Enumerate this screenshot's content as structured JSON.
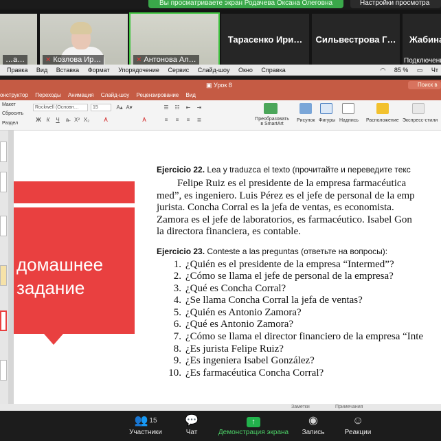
{
  "zoom": {
    "share_banner": "Вы просматриваете экран Родачева Оксана Олеговна",
    "view_options": "Настройки просмотра",
    "participants": [
      {
        "name": "",
        "label": "…а…"
      },
      {
        "name": "Козлова Ир…",
        "muted": true
      },
      {
        "name": "Антонова Ал…",
        "muted": true
      },
      {
        "name": "Тарасенко Ири…"
      },
      {
        "name": "Сильвестрова Г…"
      },
      {
        "name": "Жабина",
        "sub": "Подключение"
      }
    ],
    "toolbar": {
      "participants_label": "Участники",
      "participants_count": "15",
      "chat_label": "Чат",
      "share_label": "Демонстрация экрана",
      "record_label": "Запись",
      "reactions_label": "Реакции"
    }
  },
  "menubar": {
    "items": [
      "Правка",
      "Вид",
      "Вставка",
      "Формат",
      "Упорядочение",
      "Сервис",
      "Слайд-шоу",
      "Окно",
      "Справка"
    ],
    "battery": "85 %",
    "day": "Чт"
  },
  "powerpoint": {
    "doc_title": "Урок 8",
    "search_placeholder": "Поиск в",
    "tabs": [
      "онструктор",
      "Переходы",
      "Анимация",
      "Слайд-шоу",
      "Рецензирование",
      "Вид"
    ],
    "ribbon": {
      "layout": "Макет",
      "reset": "Сбросить",
      "section": "Раздел",
      "font": "Rockwell (Основн…",
      "size": "15",
      "smartart": "Преобразовать в SmartArt",
      "picture": "Рисунок",
      "shapes": "Фигуры",
      "textbox": "Надпись",
      "arrange": "Расположение",
      "quickstyles": "Экспресс-стили"
    },
    "status": {
      "notes": "Заметки",
      "comments": "Примечания"
    }
  },
  "slide": {
    "title_line1": "домашнее",
    "title_line2": "задание",
    "ex22_head_bold": "Ejercicio 22.",
    "ex22_head": "Lea y traduzca el texto (прочитайте и переведите текс",
    "ex22_lines": [
      "Felipe Ruiz es el presidente de la empresa farmacéutica",
      "med”, es ingeniero. Luis Pérez es el jefe de personal de la emp",
      "jurista. Concha Corral es la jefa de ventas, es economista.",
      "Zamora es el jefe de laboratorios, es farmacéutico. Isabel Gon",
      "la directora financiera, es contable."
    ],
    "ex23_head_bold": "Ejercicio 23.",
    "ex23_head": "Conteste a las preguntas (ответьте на вопросы):",
    "questions": [
      {
        "n": "1.",
        "q": "¿Quién es el presidente de la empresa “Intermed”?"
      },
      {
        "n": "2.",
        "q": "¿Cómo se llama el jefe de personal de la empresa?"
      },
      {
        "n": "3.",
        "q": "¿Qué es Concha Corral?"
      },
      {
        "n": "4.",
        "q": "¿Se llama Concha Corral la jefa de ventas?"
      },
      {
        "n": "5.",
        "q": "¿Quién es Antonio Zamora?"
      },
      {
        "n": "6.",
        "q": "¿Qué es Antonio Zamora?"
      },
      {
        "n": "7.",
        "q": "¿Cómo se llama el director financiero de la empresa “Inte"
      },
      {
        "n": "8.",
        "q": "¿Es jurista Felipe Ruiz?"
      },
      {
        "n": "9.",
        "q": "¿Es ingeniera Isabel González?"
      },
      {
        "n": "10.",
        "q": "¿Es farmacéutica Concha Corral?"
      }
    ]
  },
  "colors": {
    "accent_red": "#e94040",
    "ppt_header": "#c55b44",
    "zoom_green": "#22b24c"
  }
}
